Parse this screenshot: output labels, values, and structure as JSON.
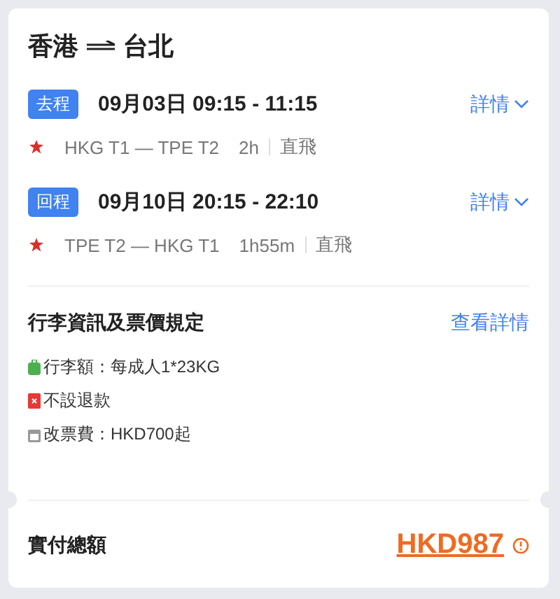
{
  "route": {
    "origin": "香港",
    "destination": "台北"
  },
  "segments": [
    {
      "tag": "去程",
      "datetime": "09月03日 09:15 - 11:15",
      "details": "詳情",
      "path": "HKG T1 — TPE T2",
      "duration": "2h",
      "type": "直飛"
    },
    {
      "tag": "回程",
      "datetime": "09月10日 20:15 - 22:10",
      "details": "詳情",
      "path": "TPE T2 — HKG T1",
      "duration": "1h55m",
      "type": "直飛"
    }
  ],
  "rules": {
    "title": "行李資訊及票價規定",
    "link": "查看詳情",
    "items": [
      {
        "kind": "baggage",
        "text": "行李額：每成人1*23KG"
      },
      {
        "kind": "refund",
        "text": "不設退款"
      },
      {
        "kind": "change",
        "text": "改票費：HKD700起"
      }
    ]
  },
  "total": {
    "label": "實付總額",
    "amount": "HKD987"
  }
}
